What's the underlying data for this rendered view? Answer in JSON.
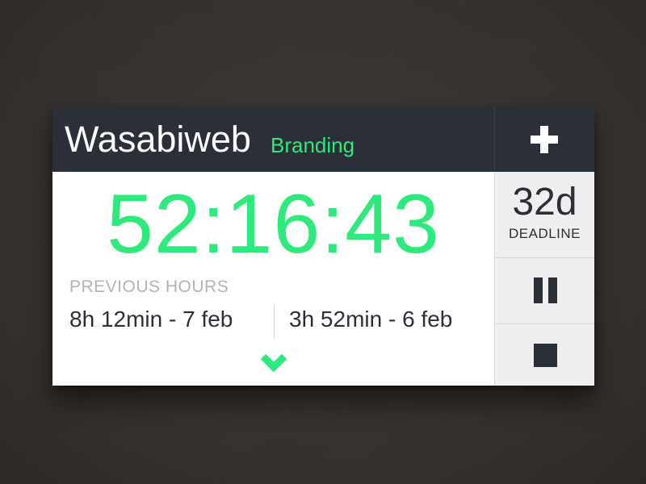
{
  "header": {
    "title": "Wasabiweb",
    "project": "Branding",
    "add_icon": "plus-icon"
  },
  "timer": {
    "elapsed": "52:16:43"
  },
  "history": {
    "label": "PREVIOUS HOURS",
    "entries": [
      "8h 12min - 7 feb",
      "3h 52min - 6 feb"
    ],
    "expand_icon": "chevron-down-icon"
  },
  "sidebar": {
    "deadline_value": "32d",
    "deadline_label": "DEADLINE",
    "pause_icon": "pause-icon",
    "stop_icon": "stop-icon"
  },
  "colors": {
    "accent": "#2ee97c",
    "dark": "#2b2f37",
    "panel": "#efefef",
    "background": "#3a3632",
    "muted_text": "#b3b3b3"
  }
}
